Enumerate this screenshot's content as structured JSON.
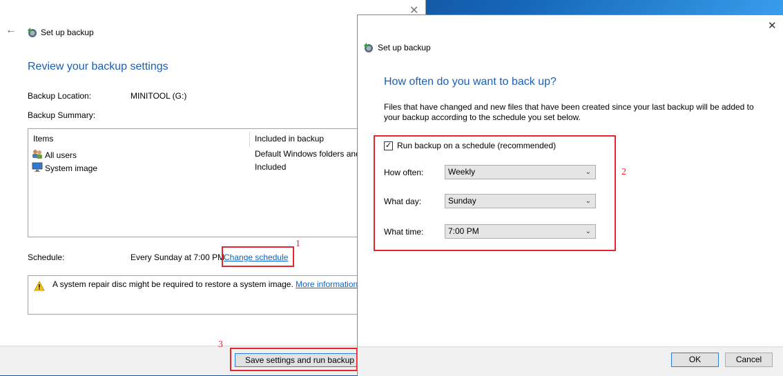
{
  "back_window": {
    "title": "Set up backup",
    "heading": "Review your backup settings",
    "backup_location_label": "Backup Location:",
    "backup_location_value": "MINITOOL (G:)",
    "backup_summary_label": "Backup Summary:",
    "summary": {
      "columns": [
        "Items",
        "Included in backup"
      ],
      "rows": [
        {
          "icon": "users-icon",
          "name": "All users",
          "value": "Default Windows folders and"
        },
        {
          "icon": "monitor-icon",
          "name": "System image",
          "value": "Included"
        }
      ]
    },
    "schedule_label": "Schedule:",
    "schedule_value": "Every Sunday at 7:00 PM",
    "change_schedule_link": "Change schedule",
    "warning_text": "A system repair disc might be required to restore a system image.",
    "warning_link": "More information",
    "save_button": "Save settings and run backup"
  },
  "dialog": {
    "title": "Set up backup",
    "heading": "How often do you want to back up?",
    "description": "Files that have changed and new files that have been created since your last backup will be added to your backup according to the schedule you set below.",
    "run_on_schedule_label": "Run backup on a schedule (recommended)",
    "run_on_schedule_checked": true,
    "how_often_label": "How often:",
    "how_often_value": "Weekly",
    "what_day_label": "What day:",
    "what_day_value": "Sunday",
    "what_time_label": "What time:",
    "what_time_value": "7:00 PM",
    "ok_button": "OK",
    "cancel_button": "Cancel"
  },
  "annotations": {
    "step1": "1",
    "step2": "2",
    "step3": "3",
    "color": "#e4262a"
  },
  "colors": {
    "heading": "#1a5fb4",
    "link": "#0b63c7"
  }
}
